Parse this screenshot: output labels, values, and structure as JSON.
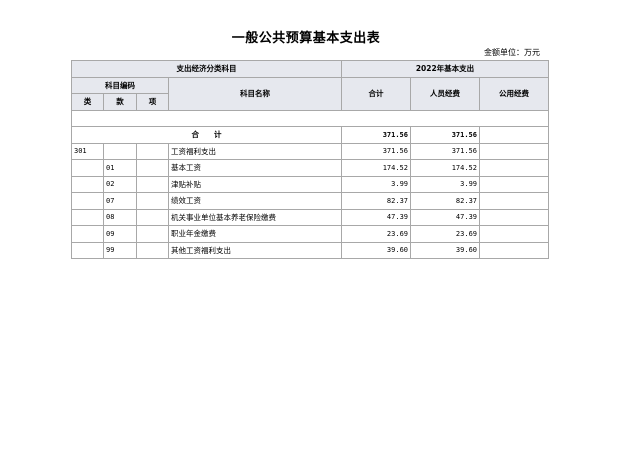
{
  "document": {
    "title": "一般公共预算基本支出表",
    "unit_label": "金额单位：万元"
  },
  "table": {
    "header": {
      "group_left": "支出经济分类科目",
      "group_right": "2022年基本支出",
      "code_group": "科目编码",
      "class": "类",
      "section": "款",
      "item": "项",
      "name": "科目名称",
      "total": "合计",
      "personnel": "人员经费",
      "public": "公用经费"
    },
    "total_row": {
      "label": "合　　计",
      "total": "371.56",
      "personnel": "371.56",
      "public": ""
    },
    "rows": [
      {
        "class": "301",
        "section": "",
        "item": "",
        "name": "工资福利支出",
        "total": "371.56",
        "personnel": "371.56",
        "public": ""
      },
      {
        "class": "",
        "section": "01",
        "item": "",
        "name": "基本工资",
        "total": "174.52",
        "personnel": "174.52",
        "public": ""
      },
      {
        "class": "",
        "section": "02",
        "item": "",
        "name": "津贴补贴",
        "total": "3.99",
        "personnel": "3.99",
        "public": ""
      },
      {
        "class": "",
        "section": "07",
        "item": "",
        "name": "绩效工资",
        "total": "82.37",
        "personnel": "82.37",
        "public": ""
      },
      {
        "class": "",
        "section": "08",
        "item": "",
        "name": "机关事业单位基本养老保险缴费",
        "total": "47.39",
        "personnel": "47.39",
        "public": ""
      },
      {
        "class": "",
        "section": "09",
        "item": "",
        "name": "职业年金缴费",
        "total": "23.69",
        "personnel": "23.69",
        "public": ""
      },
      {
        "class": "",
        "section": "99",
        "item": "",
        "name": "其他工资福利支出",
        "total": "39.60",
        "personnel": "39.60",
        "public": ""
      }
    ]
  }
}
